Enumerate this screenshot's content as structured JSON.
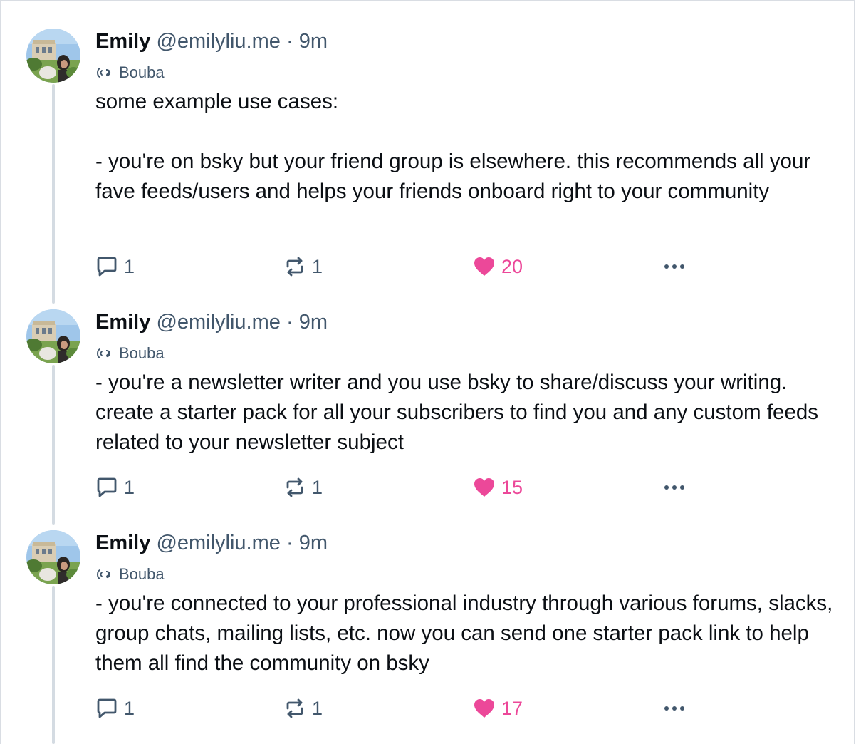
{
  "posts": [
    {
      "author": {
        "name": "Emily",
        "handle": "@emilyliu.me"
      },
      "separator": "·",
      "time": "9m",
      "label": "Bouba",
      "text": "some example use cases:\n\n- you're on bsky but your friend group is elsewhere. this recommends all your fave feeds/users and helps your friends onboard right to your community",
      "stats": {
        "replies": "1",
        "reposts": "1",
        "likes": "20"
      }
    },
    {
      "author": {
        "name": "Emily",
        "handle": "@emilyliu.me"
      },
      "separator": "·",
      "time": "9m",
      "label": "Bouba",
      "text": "- you're a newsletter writer and you use bsky to share/discuss your writing. create a starter pack for all your subscribers to find you and any custom feeds related to your newsletter subject",
      "stats": {
        "replies": "1",
        "reposts": "1",
        "likes": "15"
      }
    },
    {
      "author": {
        "name": "Emily",
        "handle": "@emilyliu.me"
      },
      "separator": "·",
      "time": "9m",
      "label": "Bouba",
      "text": "- you're connected to your professional industry through various forums, slacks, group chats, mailing lists, etc. now you can send one starter pack link to help them all find the community on bsky",
      "stats": {
        "replies": "1",
        "reposts": "1",
        "likes": "17"
      }
    }
  ],
  "icons": {
    "reply": "speech-bubble-icon",
    "repost": "repost-arrows-icon",
    "like": "heart-icon",
    "more": "ellipsis-icon",
    "label": "bouba-label-icon"
  },
  "colors": {
    "like": "#ec4899",
    "muted": "#42576c",
    "thread_line": "#d4dbe2"
  }
}
